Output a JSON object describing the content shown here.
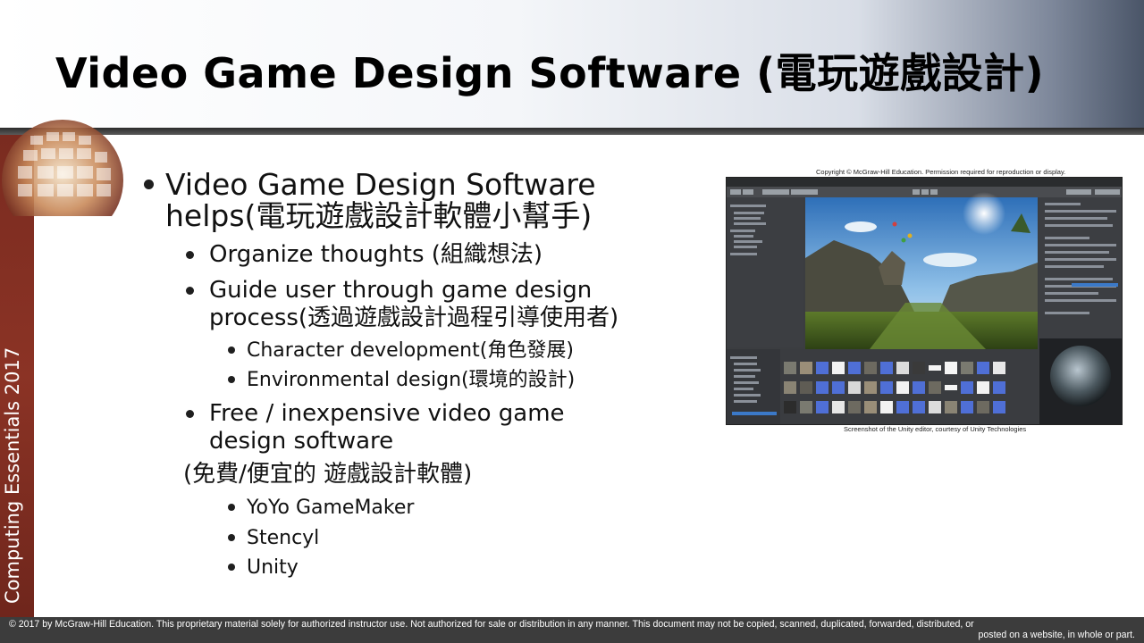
{
  "slide": {
    "title": "Video Game Design Software (電玩遊戲設計)",
    "sidebar_label": "Computing Essentials 2017",
    "footer_line1": "© 2017 by McGraw-Hill Education. This proprietary material solely for authorized instructor use. Not authorized for sale or distribution in any manner. This document may not be copied, scanned, duplicated, forwarded, distributed, or",
    "footer_line2": "posted on a website, in whole or part."
  },
  "bullets": {
    "b1_line1": "Video Game Design Software",
    "b1_line2": "helps(電玩遊戲設計軟體小幫手)",
    "b1a": "Organize thoughts (組織想法)",
    "b1b_line1": "Guide user through game design",
    "b1b_line2": "process(透過遊戲設計過程引導使用者)",
    "b1b_i": "Character development(角色發展)",
    "b1b_ii": "Environmental design(環境的設計)",
    "b1c_line1": "Free / inexpensive video game",
    "b1c_line2": "design software",
    "b1c_note": "(免費/便宜的  遊戲設計軟體)",
    "b1c_i": "YoYo GameMaker",
    "b1c_ii": "Stencyl",
    "b1c_iii": "Unity"
  },
  "screenshot": {
    "copyright_caption": "Copyright © McGraw-Hill Education. Permission required for reproduction or display.",
    "credit_caption": "Screenshot of the Unity editor, courtesy of Unity Technologies"
  },
  "colors": {
    "sidebar": "#8b3325",
    "footer": "#3c3c3c",
    "header_rule": "#2b2b2b"
  }
}
